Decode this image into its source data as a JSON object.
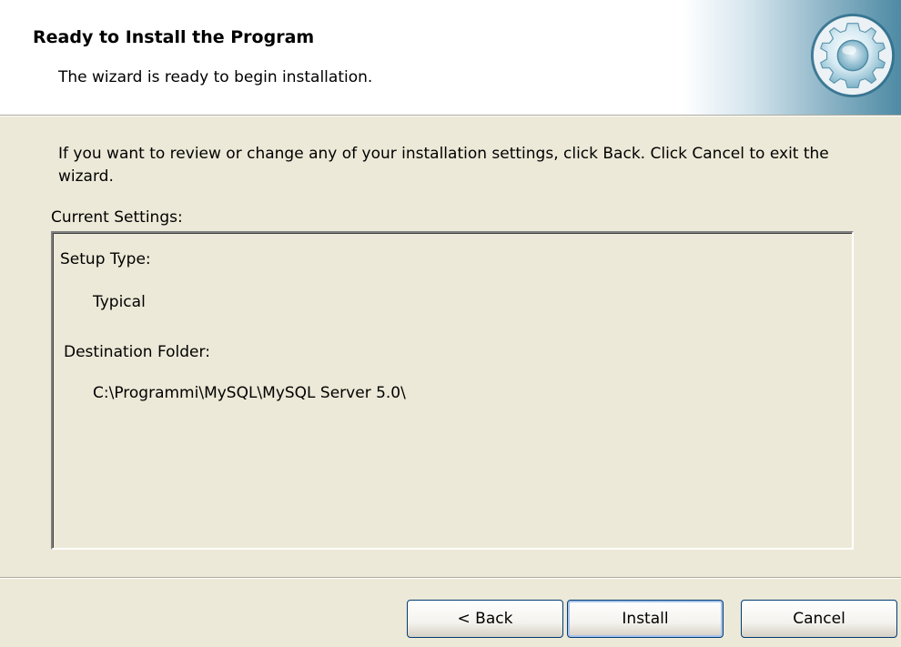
{
  "header": {
    "title": "Ready to Install the Program",
    "subtitle": "The wizard is ready to begin installation.",
    "icon": "gear-icon"
  },
  "main": {
    "instructions": "If you want to review or change any of your installation settings, click Back. Click Cancel to exit the wizard.",
    "settings_label": "Current Settings:",
    "settings": {
      "setup_type_label": "Setup Type:",
      "setup_type_value": "Typical",
      "destination_label": "Destination Folder:",
      "destination_value": "C:\\Programmi\\MySQL\\MySQL Server 5.0\\"
    }
  },
  "buttons": {
    "back": "< Back",
    "install": "Install",
    "cancel": "Cancel"
  },
  "colors": {
    "dialog_bg": "#ece9d8",
    "button_border": "#003c74"
  }
}
